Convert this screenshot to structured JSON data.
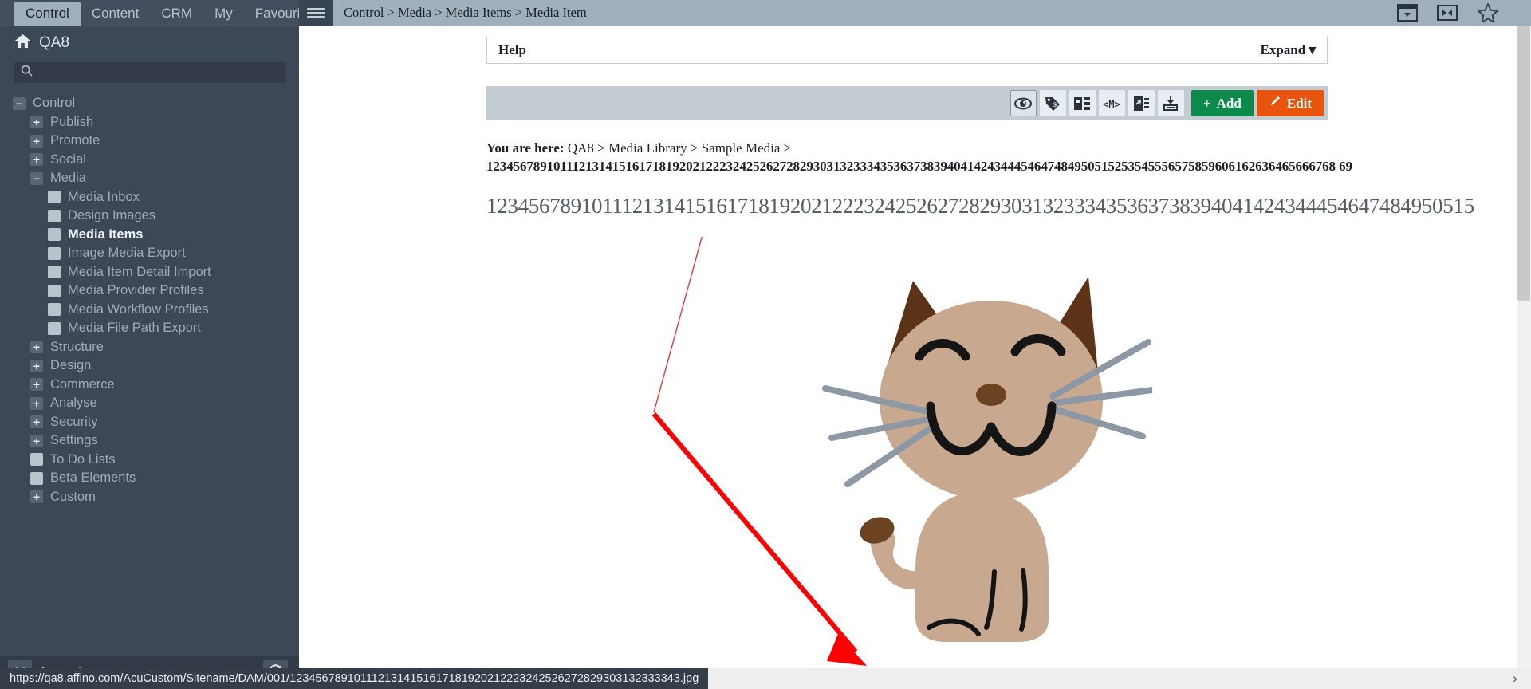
{
  "topbar": {
    "tabs": [
      {
        "label": "Control",
        "active": true
      },
      {
        "label": "Content",
        "active": false
      },
      {
        "label": "CRM",
        "active": false
      },
      {
        "label": "My",
        "active": false
      },
      {
        "label": "Favourites",
        "active": false
      }
    ],
    "menu_icon": "hamburger-icon",
    "breadcrumb": "Control > Media > Media Items > Media Item",
    "right_icons": [
      "window-dropdown-icon",
      "collapse-panel-icon",
      "star-icon"
    ]
  },
  "sidebar": {
    "home_label": "QA8",
    "home_icon": "home-icon",
    "search": {
      "value": "",
      "placeholder": "",
      "icon": "search-icon"
    },
    "tree": [
      {
        "label": "Control",
        "level": 0,
        "toggle": "minus",
        "bold": false
      },
      {
        "label": "Publish",
        "level": 1,
        "toggle": "plus",
        "bold": false
      },
      {
        "label": "Promote",
        "level": 1,
        "toggle": "plus",
        "bold": false
      },
      {
        "label": "Social",
        "level": 1,
        "toggle": "plus",
        "bold": false
      },
      {
        "label": "Media",
        "level": 1,
        "toggle": "minus",
        "bold": false
      },
      {
        "label": "Media Inbox",
        "level": 2,
        "toggle": "leaf",
        "bold": false
      },
      {
        "label": "Design Images",
        "level": 2,
        "toggle": "leaf",
        "bold": false
      },
      {
        "label": "Media Items",
        "level": 2,
        "toggle": "leaf",
        "bold": true
      },
      {
        "label": "Image Media Export",
        "level": 2,
        "toggle": "leaf",
        "bold": false
      },
      {
        "label": "Media Item Detail Import",
        "level": 2,
        "toggle": "leaf",
        "bold": false
      },
      {
        "label": "Media Provider Profiles",
        "level": 2,
        "toggle": "leaf",
        "bold": false
      },
      {
        "label": "Media Workflow Profiles",
        "level": 2,
        "toggle": "leaf",
        "bold": false
      },
      {
        "label": "Media File Path Export",
        "level": 2,
        "toggle": "leaf",
        "bold": false
      },
      {
        "label": "Structure",
        "level": 1,
        "toggle": "plus",
        "bold": false
      },
      {
        "label": "Design",
        "level": 1,
        "toggle": "plus",
        "bold": false
      },
      {
        "label": "Commerce",
        "level": 1,
        "toggle": "plus",
        "bold": false
      },
      {
        "label": "Analyse",
        "level": 1,
        "toggle": "plus",
        "bold": false
      },
      {
        "label": "Security",
        "level": 1,
        "toggle": "plus",
        "bold": false
      },
      {
        "label": "Settings",
        "level": 1,
        "toggle": "plus",
        "bold": false
      },
      {
        "label": "To Do Lists",
        "level": 1,
        "toggle": "leaf",
        "bold": false
      },
      {
        "label": "Beta Elements",
        "level": 1,
        "toggle": "leaf",
        "bold": false
      },
      {
        "label": "Custom",
        "level": 1,
        "toggle": "plus",
        "bold": false
      }
    ],
    "logout_label": "Logout",
    "logout_icon": "close-x-icon",
    "refresh_icon": "refresh-icon"
  },
  "main": {
    "help": {
      "label": "Help",
      "expand_label": "Expand"
    },
    "toolbar": {
      "icons": [
        {
          "name": "preview-eye-icon",
          "selected": true
        },
        {
          "name": "price-tag-icon",
          "selected": false
        },
        {
          "name": "structure-grid-icon",
          "selected": false
        },
        {
          "name": "markup-code-icon",
          "selected": false
        },
        {
          "name": "duplicate-page-icon",
          "selected": false
        },
        {
          "name": "download-icon",
          "selected": false
        }
      ],
      "add_label": "Add",
      "edit_label": "Edit"
    },
    "you_are_here": {
      "prefix": "You are here:",
      "path": "QA8 > Media Library > Sample Media >",
      "item_name": "1234567891011121314151617181920212223242526272829303132333435363738394041424344454647484950515253545556575859606162636465666768 69"
    },
    "page_heading": "1234567891011121314151617181920212223242526272829303132333435363738394041424344454647484950515",
    "image": {
      "alt": "cat-illustration",
      "body_color": "#c9a890",
      "ear_color": "#5c3317",
      "feature_color": "#151515",
      "whisker_color": "#8c98a4"
    },
    "annotation": {
      "type": "red-arrow",
      "color": "#ff0000"
    }
  },
  "statusbar": {
    "url": "https://qa8.affino.com/AcuCustom/Sitename/DAM/001/1234567891011121314151617181920212223242526272829303132333343.jpg",
    "chevron": "›"
  },
  "theme": {
    "sidebar_bg": "#3d4857",
    "topbar_bg": "#434f5e",
    "crumb_bg": "#9fb0bc",
    "toolbar_bg": "#c2ccd2",
    "add_green": "#0b8a4b",
    "edit_orange": "#e8540c"
  }
}
